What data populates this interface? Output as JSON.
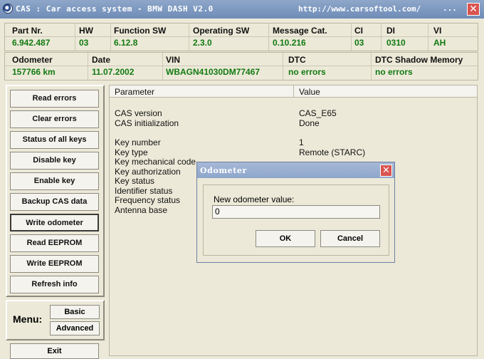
{
  "window": {
    "title": "CAS : Car access system - BMW DASH  V2.0",
    "url": "http://www.carsoftool.com/",
    "menu_dots": "..."
  },
  "info_row1": {
    "headers": [
      "Part Nr.",
      "HW",
      "Function SW",
      "Operating SW",
      "Message Cat.",
      "CI",
      "DI",
      "VI"
    ],
    "values": [
      "6.942.487",
      "03",
      "6.12.8",
      "2.3.0",
      "0.10.216",
      "03",
      "0310",
      "AH"
    ]
  },
  "info_row2": {
    "headers": [
      "Odometer",
      "Date",
      "VIN",
      "DTC",
      "DTC Shadow Memory"
    ],
    "values": [
      "157766 km",
      "11.07.2002",
      "WBAGN41030DM77467",
      "no errors",
      "no errors"
    ]
  },
  "left_buttons": [
    "Read errors",
    "Clear errors",
    "Status of all keys",
    "Disable key",
    "Enable key",
    "Backup CAS data",
    "Write odometer",
    "Read EEPROM",
    "Write EEPROM",
    "Refresh info"
  ],
  "menu": {
    "label": "Menu:",
    "basic": "Basic",
    "advanced": "Advanced"
  },
  "exit_label": "Exit",
  "list": {
    "col_parameter": "Parameter",
    "col_value": "Value",
    "rows": [
      {
        "param": "CAS version",
        "value": "CAS_E65"
      },
      {
        "param": "CAS initialization",
        "value": "Done"
      },
      {
        "param": "Key number",
        "value": "1"
      },
      {
        "param": "Key type",
        "value": "Remote (STARC)"
      },
      {
        "param": "Key mechanical code",
        "value": ""
      },
      {
        "param": "Key authorization",
        "value": ""
      },
      {
        "param": "Key status",
        "value": ""
      },
      {
        "param": "Identifier status",
        "value": ""
      },
      {
        "param": "Frequency status",
        "value": ""
      },
      {
        "param": "Antenna base",
        "value": ""
      }
    ]
  },
  "dialog": {
    "title": "Odometer",
    "label": "New odometer value:",
    "input_value": "0",
    "ok": "OK",
    "cancel": "Cancel"
  },
  "colors": {
    "value_green": "#127a12",
    "title_bar": "#7f99c1",
    "close_red": "#d9534f"
  }
}
